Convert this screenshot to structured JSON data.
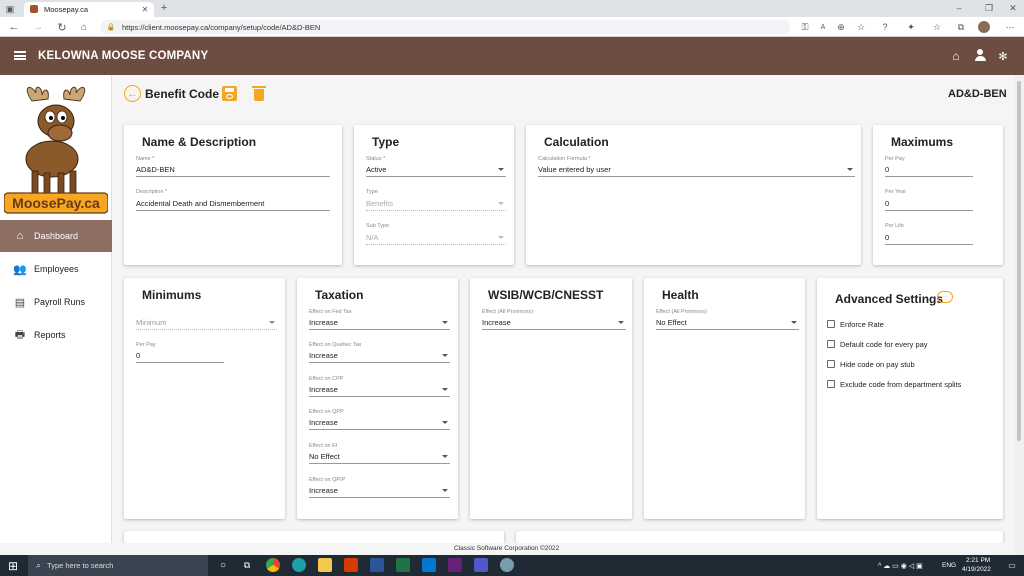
{
  "browser": {
    "tab_title": "Moosepay.ca",
    "url": "https://client.moosepay.ca/company/setup/code/AD&D-BEN"
  },
  "app": {
    "company_name": "KELOWNA MOOSE COMPANY",
    "brand_color": "#6d4c41",
    "logo_text": "MoosePay.ca"
  },
  "sidebar": {
    "items": [
      {
        "label": "Dashboard",
        "icon": "home-icon",
        "active": true
      },
      {
        "label": "Employees",
        "icon": "people-icon",
        "active": false
      },
      {
        "label": "Payroll Runs",
        "icon": "cheque-icon",
        "active": false
      },
      {
        "label": "Reports",
        "icon": "printer-icon",
        "active": false
      }
    ]
  },
  "header": {
    "title": "Benefit Code",
    "code": "AD&D-BEN",
    "accent_color": "#f5a623"
  },
  "name_desc": {
    "title": "Name & Description",
    "name_label": "Name *",
    "name_value": "AD&D-BEN",
    "desc_label": "Description *",
    "desc_value": "Accidental Death and Dismemberment"
  },
  "type": {
    "title": "Type",
    "status_label": "Status *",
    "status_value": "Active",
    "type_label": "Type",
    "type_value": "Benefits",
    "subtype_label": "Sub Type",
    "subtype_value": "N/A"
  },
  "calculation": {
    "title": "Calculation",
    "formula_label": "Calculation Formula *",
    "formula_value": "Value entered by user"
  },
  "maximums": {
    "title": "Maximums",
    "per_pay_label": "Per Pay",
    "per_pay_value": "0",
    "per_year_label": "Per Year",
    "per_year_value": "0",
    "per_life_label": "Per Life",
    "per_life_value": "0"
  },
  "minimums": {
    "title": "Minimums",
    "min_placeholder": "Minimum",
    "per_pay_label": "Per Pay",
    "per_pay_value": "0"
  },
  "taxation": {
    "title": "Taxation",
    "fields": [
      {
        "label": "Effect on Fed Tax",
        "value": "Increase"
      },
      {
        "label": "Effect on Quebec Tax",
        "value": "Increase"
      },
      {
        "label": "Effect on CPP",
        "value": "Increase"
      },
      {
        "label": "Effect on QPP",
        "value": "Increase"
      },
      {
        "label": "Effect on EI",
        "value": "No Effect"
      },
      {
        "label": "Effect on QPIP",
        "value": "Increase"
      }
    ]
  },
  "wsib": {
    "title": "WSIB/WCB/CNESST",
    "label": "Effect (All Provinces)",
    "value": "Increase"
  },
  "health": {
    "title": "Health",
    "label": "Effect (All Provinces)",
    "value": "No Effect"
  },
  "advanced": {
    "title": "Advanced Settings",
    "options": [
      "Enforce Rate",
      "Default code for every pay",
      "Hide code on pay stub",
      "Exclude code from department splits"
    ]
  },
  "footer": {
    "text": "Classic Software Corporation  ©2022"
  },
  "taskbar": {
    "search_placeholder": "Type here to search",
    "time": "2:21 PM",
    "date": "4/19/2022",
    "lang": "ENG"
  }
}
